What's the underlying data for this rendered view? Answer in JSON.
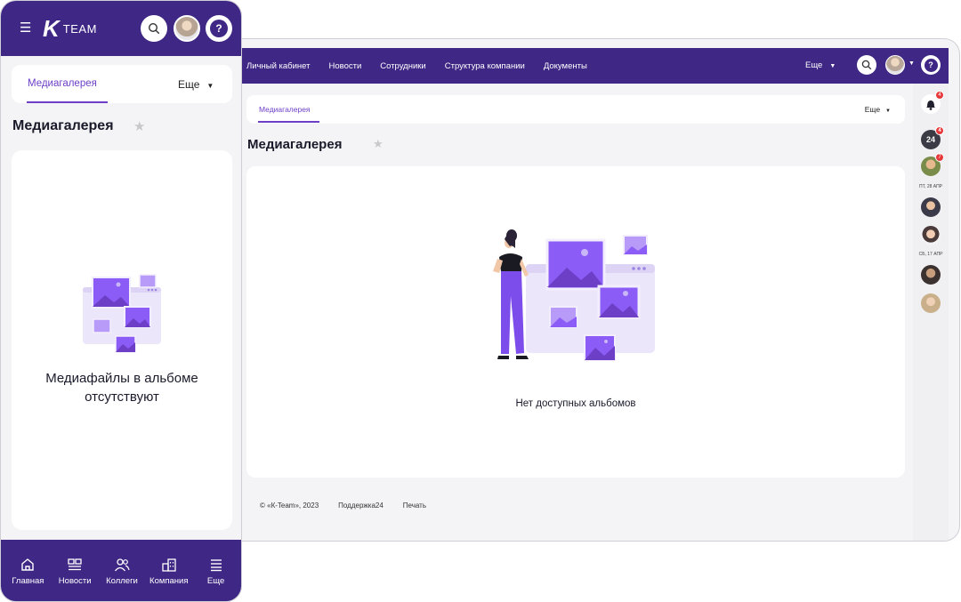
{
  "desktop": {
    "nav": [
      "Личный кабинет",
      "Новости",
      "Сотрудники",
      "Структура компании",
      "Документы"
    ],
    "more_label": "Еще",
    "tab_active": "Медиагалерея",
    "tab_more": "Еще",
    "title": "Медиагалерея",
    "empty_text": "Нет доступных альбомов",
    "footer": {
      "copyright": "© «К-Team», 2023",
      "support": "Поддержка24",
      "print": "Печать"
    },
    "rail": {
      "notification_count": "4",
      "chat_label": "24",
      "chat_count": "4",
      "user_count": "7",
      "date_1": "ПТ, 28 АПР",
      "date_2": "СБ, 17 АПР"
    }
  },
  "mobile": {
    "logo_text": "TEAM",
    "tab_active": "Медиагалерея",
    "tab_more": "Еще",
    "title": "Медиагалерея",
    "empty_line1": "Медиафайлы в альбоме",
    "empty_line2": "отсутствуют",
    "bottom_nav": [
      "Главная",
      "Новости",
      "Коллеги",
      "Компания",
      "Еще"
    ]
  },
  "colors": {
    "brand": "#3f2785",
    "accent": "#6d3fc7",
    "illustration": "#8b5cf6",
    "badge": "#e5393b"
  }
}
